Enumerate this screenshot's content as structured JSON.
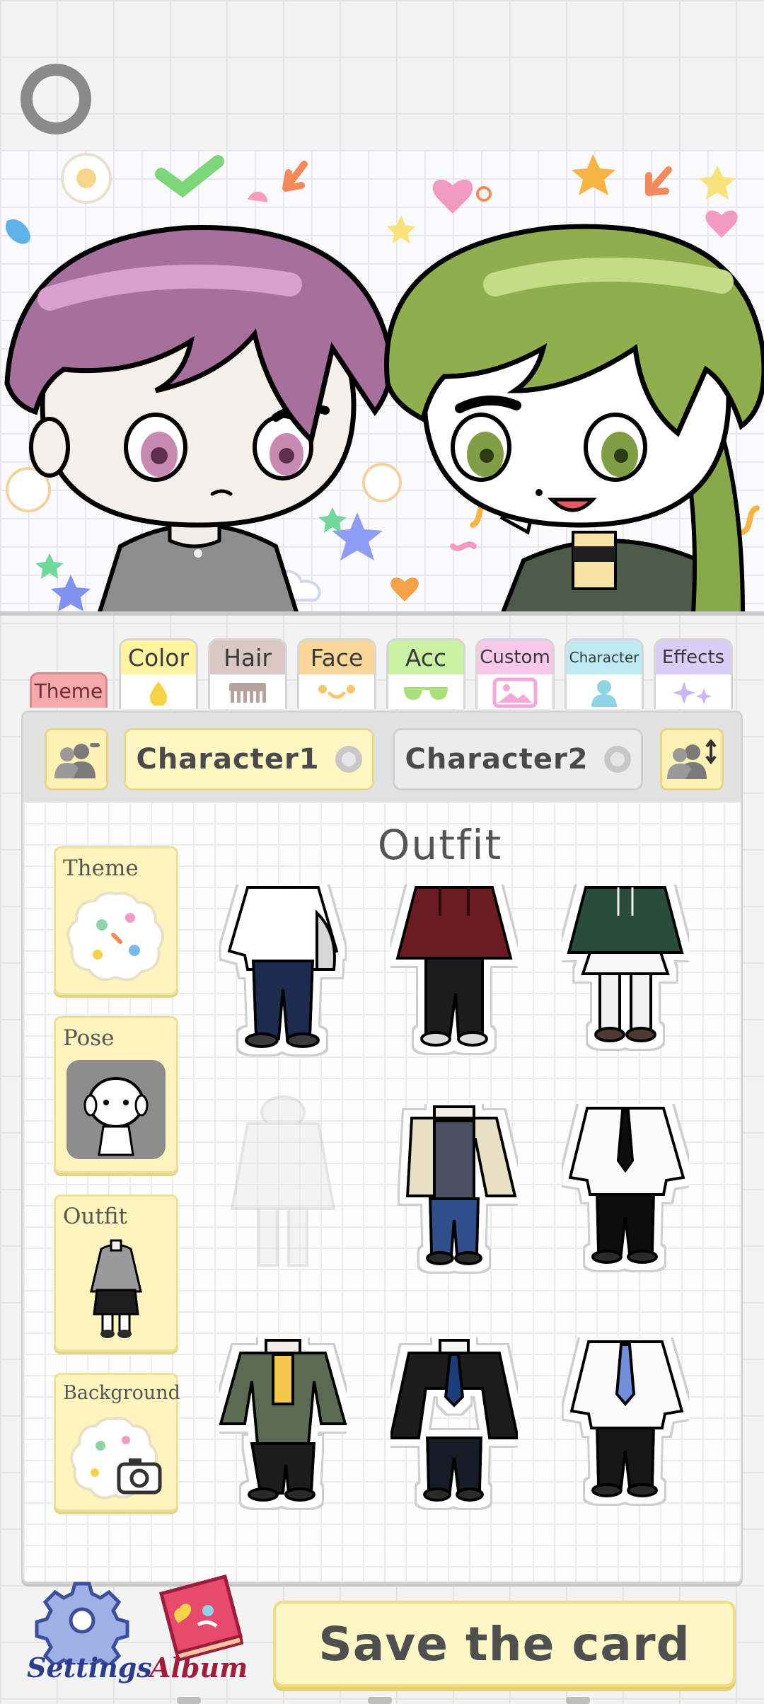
{
  "tabs": [
    {
      "label": "Color",
      "bg": "#fff3a0",
      "icon": "drop-icon"
    },
    {
      "label": "Hair",
      "bg": "#d8c7c2",
      "icon": "comb-icon"
    },
    {
      "label": "Face",
      "bg": "#f9d79a",
      "icon": "face-icon"
    },
    {
      "label": "Acc",
      "bg": "#c9f0a3",
      "icon": "glasses-icon"
    },
    {
      "label": "Custom",
      "bg": "#f8c8ea",
      "icon": "image-icon"
    },
    {
      "label": "Character",
      "bg": "#bfeaf2",
      "icon": "person-icon"
    },
    {
      "label": "Effects",
      "bg": "#dccdf6",
      "icon": "sparkle-icon"
    }
  ],
  "theme_tab": "Theme",
  "characters": {
    "char1": "Character1",
    "char2": "Character2"
  },
  "section_title": "Outfit",
  "side_menu": {
    "theme": "Theme",
    "pose": "Pose",
    "outfit": "Outfit",
    "background": "Background"
  },
  "bottom": {
    "settings": "Settings",
    "album": "Album",
    "save": "Save the card"
  }
}
